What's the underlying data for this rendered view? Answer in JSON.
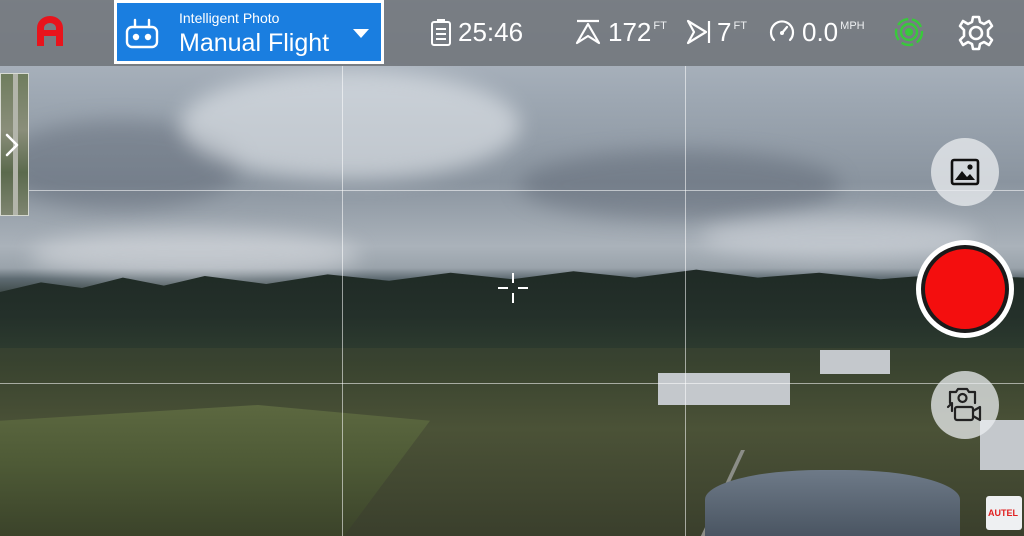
{
  "topbar": {
    "home_icon": "autel-logo-icon",
    "mode": {
      "subtitle": "Intelligent Photo",
      "title": "Manual Flight",
      "icon": "remote-controller-icon"
    },
    "stats": {
      "flight_time": {
        "icon": "battery-icon",
        "value": "25:46"
      },
      "altitude": {
        "icon": "altitude-icon",
        "value": "172",
        "unit": "FT"
      },
      "distance": {
        "icon": "distance-icon",
        "value": "7",
        "unit": "FT"
      },
      "speed": {
        "icon": "speedometer-icon",
        "value": "0.0",
        "unit": "MPH"
      }
    },
    "gps_icon": "gps-signal-icon",
    "gps_color": "#39c93b",
    "settings_icon": "gear-icon"
  },
  "left_panel": {
    "map_thumbnail": "map-thumbnail",
    "expand_icon": "chevron-right-icon"
  },
  "right_panel": {
    "gallery_icon": "image-gallery-icon",
    "record_color": "#f40e0e",
    "mode_switch_icon": "photo-video-switch-icon"
  },
  "watermark": {
    "text": "AUTEL"
  },
  "accent_color": "#1a7ee0"
}
